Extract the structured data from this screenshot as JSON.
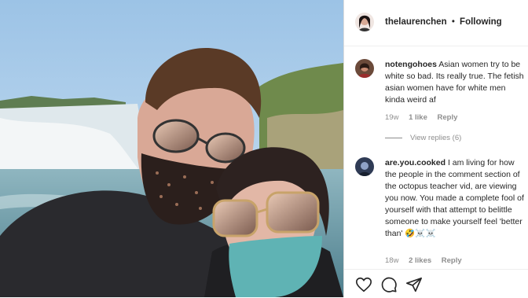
{
  "header": {
    "username": "thelaurenchen",
    "separator": "•",
    "follow_status": "Following"
  },
  "comments": [
    {
      "username": "notengohoes",
      "text": "Asian women try to be white so bad. Its really true. The fetish asian women have for white men kinda weird af",
      "age": "19w",
      "likes": "1 like",
      "reply": "Reply",
      "view_replies": "View replies (6)"
    },
    {
      "username": "are.you.cooked",
      "text": "I am living for how the people in the comment section of the octopus teacher vid, are viewing you now. You made a complete fool of yourself with that attempt to belittle someone to make yourself feel 'better than' 🤣☠️☠️",
      "age": "18w",
      "likes": "2 likes",
      "reply": "Reply"
    }
  ],
  "icons": [
    "heart-icon",
    "comment-icon",
    "share-icon"
  ]
}
